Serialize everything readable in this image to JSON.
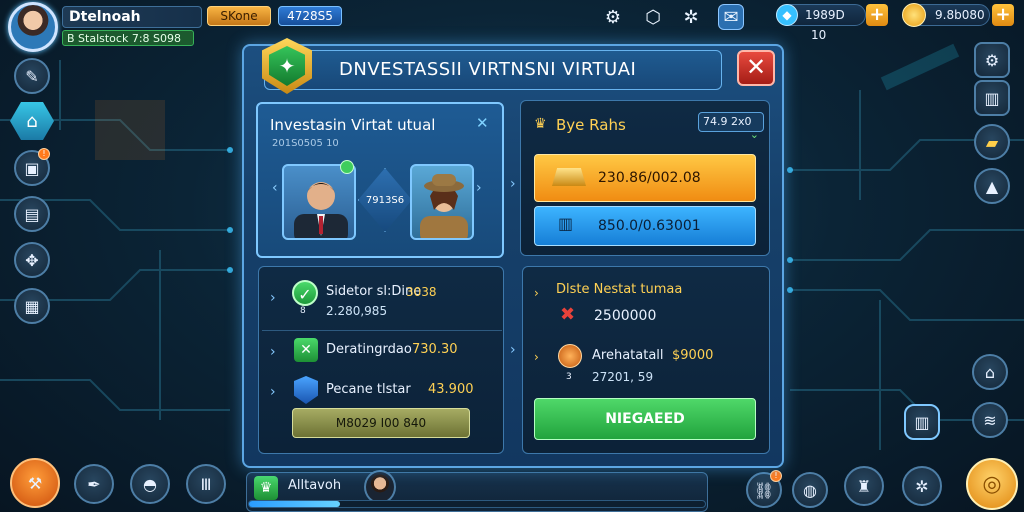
{
  "player": {
    "name": "Dtelnoah",
    "subtitle": "B Stalstock  7:8 S098"
  },
  "header": {
    "pill_orange": "SKone",
    "pill_blue": "4728S5"
  },
  "resources": {
    "gems": "1989D",
    "gems_multiplier": "10",
    "coins": "9.8b080"
  },
  "dialog": {
    "title": "DNVESTASSII VIRTNSNI VIRTUAI",
    "close_label": "✕",
    "card": {
      "title": "Investasin Virtat utual",
      "subtitle": "201S0505 10",
      "vs_label": "7913S6"
    },
    "buy": {
      "label": "Bye Rahs",
      "dropdown": "74.9 2x0",
      "gold_value": "230.86/002.08",
      "blue_value": "850.0/0.63001"
    },
    "left_list": {
      "items": [
        {
          "label": "Sidetor sl:Dine",
          "value": "3038",
          "sub": "2.280,985",
          "tag": "8"
        },
        {
          "label": "Deratingrdao",
          "value": "730.30"
        },
        {
          "label": "Pecane tlstar",
          "value": "43.900"
        }
      ],
      "button": "M8029 I00 840"
    },
    "right_list": {
      "header": "Dlste Nestat tumaa",
      "items": [
        {
          "value": "2500000"
        },
        {
          "label": "Arehatatall",
          "value": "$9000",
          "sub": "27201, 59",
          "tag": "3"
        }
      ],
      "button": "NIEGAEED"
    }
  },
  "bottom": {
    "name": "Alltavoh",
    "progress": 0.2
  },
  "colors": {
    "accent": "#5ca6e3",
    "gold": "#ffc844",
    "green": "#3fcd5d",
    "danger": "#e84a3e"
  }
}
